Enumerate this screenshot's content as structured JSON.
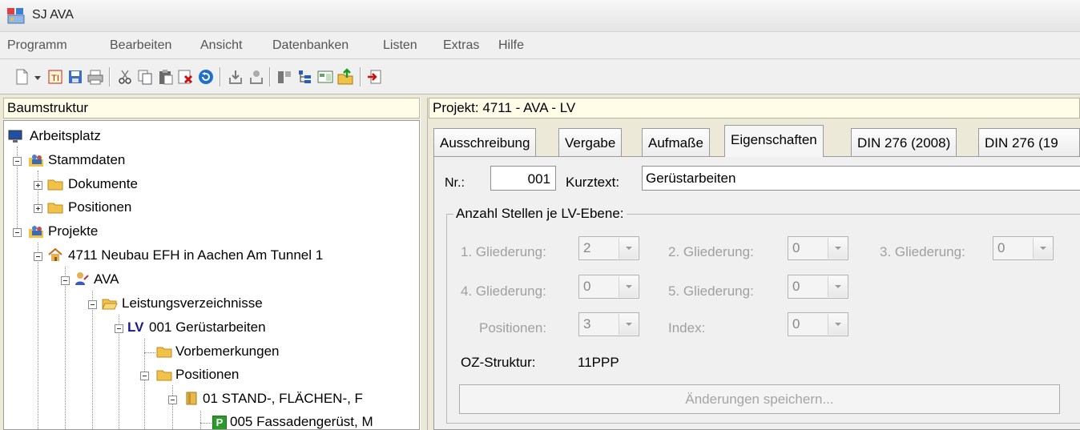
{
  "app": {
    "title": "SJ AVA"
  },
  "menu": [
    "Programm",
    "Bearbeiten",
    "Ansicht",
    "Datenbanken",
    "Listen",
    "Extras",
    "Hilfe"
  ],
  "left": {
    "header": "Baumstruktur",
    "tree": [
      {
        "label": "Arbeitsplatz",
        "icon": "computer-icon"
      },
      {
        "label": "Stammdaten",
        "icon": "people-folder-icon"
      },
      {
        "label": "Dokumente",
        "icon": "folder-icon"
      },
      {
        "label": "Positionen",
        "icon": "folder-icon"
      },
      {
        "label": "Projekte",
        "icon": "people-folder-icon"
      },
      {
        "label": "4711 Neubau EFH in Aachen Am Tunnel 1",
        "icon": "house-icon"
      },
      {
        "label": "AVA",
        "icon": "user-icon"
      },
      {
        "label": "Leistungsverzeichnisse",
        "icon": "open-folder-icon"
      },
      {
        "badge": "LV",
        "label": "001 Gerüstarbeiten"
      },
      {
        "label": "Vorbemerkungen",
        "icon": "folder-icon"
      },
      {
        "label": "Positionen",
        "icon": "folder-icon"
      },
      {
        "label": "01 STAND-, FLÄCHEN-, F",
        "icon": "book-icon"
      },
      {
        "label": "005 Fassadengerüst, M",
        "icon": "position-p-icon",
        "icon_letter": "P"
      }
    ]
  },
  "right": {
    "header": "Projekt: 4711 - AVA - LV",
    "tabs": [
      "Ausschreibung",
      "Vergabe",
      "Aufmaße",
      "Eigenschaften",
      "DIN 276 (2008)",
      "DIN 276 (19"
    ],
    "active_tab": "Eigenschaften",
    "form": {
      "nr_label": "Nr.:",
      "nr_value": "001",
      "kurztext_label": "Kurztext:",
      "kurztext_value": "Gerüstarbeiten",
      "group_title": "Anzahl Stellen je LV-Ebene:",
      "fields": [
        {
          "label": "1. Gliederung:",
          "value": "2"
        },
        {
          "label": "2. Gliederung:",
          "value": "0"
        },
        {
          "label": "3. Gliederung:",
          "value": "0"
        },
        {
          "label": "4. Gliederung:",
          "value": "0"
        },
        {
          "label": "5. Gliederung:",
          "value": "0"
        },
        {
          "label": "Positionen:",
          "value": "3"
        },
        {
          "label": "Index:",
          "value": "0"
        }
      ],
      "oz_label": "OZ-Struktur:",
      "oz_value": "11PPP",
      "save_button": "Änderungen speichern..."
    }
  }
}
